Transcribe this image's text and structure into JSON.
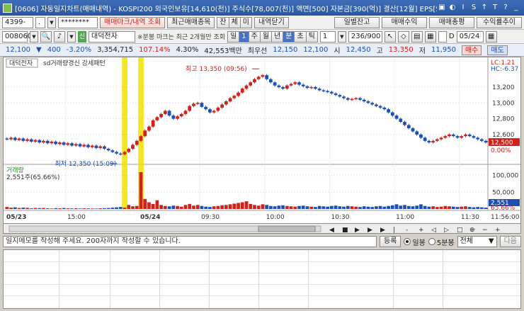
{
  "window": {
    "title": "[0606] 자동일지차트(매매내역) - KOSPI200 외국인보유[14,610(천)] 주식수[78,007(천)] 액면[500] 자본금[390(억)] 결산[12월] EPS[5,152] PER[2.",
    "controls": [
      "▣",
      "◐",
      "I",
      "S",
      "↑",
      "T",
      "?",
      "_"
    ]
  },
  "toolbar1": {
    "account_value": "4399-",
    "account_suffix": ".",
    "password_value": "********",
    "btn_trade_mark": "매매마크/내역 조회",
    "btn_recent": "최근매매종목",
    "seg": [
      "잔",
      "체",
      "미"
    ],
    "btn_close_detail": "내역닫기",
    "btn_daily_balance": "일별잔고",
    "btn_trade_profit": "매매수익",
    "btn_trade_total": "매매총평",
    "btn_profit_trend": "수익률추이"
  },
  "toolbar2": {
    "code_value": "008060",
    "stock_name": "대덕전자",
    "green_tag": "신",
    "note": "※분봉 마크는 최근 2개월만 조회",
    "period_tabs": [
      "일",
      "1",
      "주",
      "월",
      "년",
      "분",
      "초",
      "틱"
    ],
    "interval_value": "1",
    "count_value": "236/900",
    "date_value": "05/24",
    "checkbox_label": "D"
  },
  "quote": {
    "price": "12,100",
    "change": "400",
    "change_pct": "-3.20%",
    "volume": "3,354,715",
    "vol_ratio": "107.14%",
    "turnover": "4.30%",
    "amount": "42,553백만",
    "best_ask_label": "최우선",
    "best_ask": "12,150",
    "best_bid": "12,100",
    "open_label": "시",
    "open": "12,450",
    "high_label": "고",
    "high": "13,350",
    "low_label": "저",
    "low": "11,950",
    "buy_btn": "매수",
    "sell_btn": "매도"
  },
  "chart_panel": {
    "title": "대덕전자",
    "indicator": "sd거래량경신 강세패턴",
    "lc_label": "LC:1.21",
    "hc_label": "HC:-6.37",
    "high_marker": "최고 13,350 (09:56)",
    "low_marker": "최저 12,350 (15:09)",
    "current_price_tag": "12,500",
    "current_pct_tag": "0.00%",
    "volume_title": "거래량",
    "volume_value": "2,551주(65.66%)",
    "volume_tag_value": "2,551",
    "volume_tag_pct": "65.66%",
    "time_end": "11:56:00"
  },
  "chart_data": {
    "type": "candlestick",
    "x_ticks": [
      "05/23",
      "15:00",
      "05/24",
      "09:30",
      "10:00",
      "10:30",
      "11:00",
      "11:30"
    ],
    "price_axis": {
      "ticks": [
        12600,
        12800,
        13000,
        13200
      ],
      "ylim": [
        12250,
        13450
      ]
    },
    "volume_axis": {
      "ticks": [
        50000,
        100000
      ],
      "ylim": [
        0,
        110000
      ]
    },
    "series": [
      {
        "name": "price_close",
        "values": [
          12540,
          12560,
          12530,
          12550,
          12520,
          12540,
          12510,
          12530,
          12500,
          12520,
          12490,
          12510,
          12480,
          12500,
          12470,
          12490,
          12460,
          12480,
          12450,
          12470,
          12440,
          12460,
          12430,
          12450,
          12420,
          12400,
          12380,
          12360,
          12350,
          12380,
          12420,
          12470,
          12520,
          12580,
          12650,
          12700,
          12780,
          12820,
          12860,
          12900,
          12840,
          12800,
          12830,
          12860,
          12900,
          12960,
          12990,
          13000,
          12950,
          12920,
          12880,
          12900,
          12940,
          12980,
          13020,
          13060,
          13090,
          13130,
          13180,
          13220,
          13260,
          13300,
          13330,
          13350,
          13300,
          13260,
          13220,
          13200,
          13180,
          13220,
          13240,
          13260,
          13230,
          13210,
          13190,
          13200,
          13180,
          13160,
          13150,
          13140,
          13120,
          13100,
          13080,
          13060,
          13040,
          13050,
          13060,
          13040,
          13020,
          13000,
          12980,
          12960,
          12940,
          12920,
          12880,
          12840,
          12800,
          12760,
          12720,
          12680,
          12640,
          12600,
          12560,
          12520,
          12500,
          12520,
          12540,
          12560,
          12580,
          12600,
          12580,
          12560,
          12580,
          12600,
          12580,
          12560,
          12540,
          12520,
          12500
        ]
      },
      {
        "name": "volume",
        "values": [
          6000,
          4000,
          5000,
          3000,
          4000,
          3500,
          2000,
          3000,
          2500,
          3000,
          2000,
          1500,
          2500,
          2000,
          3000,
          2000,
          1800,
          2200,
          1500,
          2000,
          1800,
          1600,
          1400,
          2000,
          2500,
          3000,
          4000,
          5000,
          6000,
          4000,
          12000,
          8000,
          9000,
          110000,
          30000,
          20000,
          15000,
          26000,
          12000,
          9000,
          8000,
          10000,
          9000,
          7000,
          12000,
          15000,
          10000,
          12000,
          9000,
          7000,
          6000,
          8000,
          9000,
          11000,
          12000,
          14000,
          16000,
          18000,
          20000,
          23000,
          15000,
          12000,
          10000,
          14000,
          12000,
          9000,
          8000,
          10000,
          11000,
          9000,
          8000,
          7000,
          9000,
          10000,
          8000,
          7000,
          6000,
          9000,
          8000,
          7000,
          9000,
          10000,
          8000,
          7000,
          9000,
          8000,
          7000,
          6000,
          8000,
          7000,
          6000,
          8000,
          9000,
          7000,
          9000,
          11000,
          14000,
          10000,
          12000,
          9000,
          8000,
          10000,
          14000,
          9000,
          7000,
          8000,
          6000,
          7000,
          9000,
          8000,
          7000,
          6000,
          7000,
          8000,
          6000,
          5000,
          6000,
          5000,
          4000
        ]
      }
    ]
  },
  "memo": {
    "placeholder": "일지메모를 작성해 주세요. 200자까지 작성할 수 있습니다.",
    "register_btn": "등록",
    "radio_daily": "일봉",
    "radio_5min": "5분봉",
    "filter_value": "전체",
    "next_btn": "다음"
  },
  "colors": {
    "up": "#d0211a",
    "down": "#1d4fb3",
    "highlight": "#f2e000"
  }
}
